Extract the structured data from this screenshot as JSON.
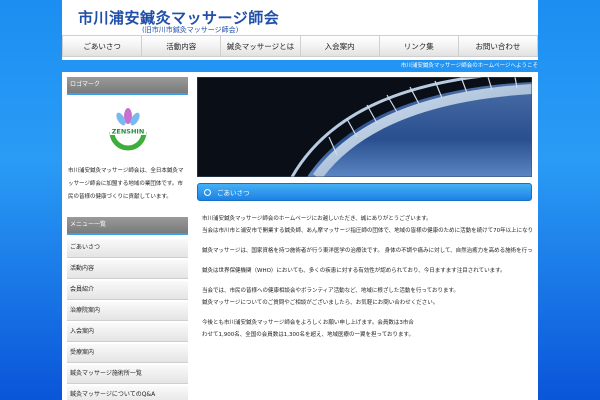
{
  "header": {
    "title": "市川浦安鍼灸マッサージ師会",
    "subtitle": "(旧市川市鍼灸マッサージ師会)"
  },
  "nav": {
    "items": [
      "ごあいさつ",
      "活動内容",
      "鍼灸マッサージとは",
      "入会案内",
      "リンク集",
      "お問い合わせ"
    ]
  },
  "ticker": "市川浦安鍼灸マッサージ師会のホームページへようこそ",
  "sidebar": {
    "logo_heading": "ロゴマーク",
    "logo_text": "ZENSHIN",
    "description": "市川浦安鍼灸マッサージ師会は、全日本鍼灸マッサージ師会に加盟する地域の業団体です。市民の皆様の健康づくりに貢献しています。",
    "menu_heading": "メニュー一覧",
    "menu_items": [
      "ごあいさつ",
      "活動内容",
      "会員紹介",
      "治療院案内",
      "入会案内",
      "受療案内",
      "鍼灸マッサージ施術所一覧",
      "鍼灸マッサージについてのQ&A"
    ]
  },
  "content": {
    "section_title": "ごあいさつ",
    "paragraphs": [
      "市川浦安鍼灸マッサージ師会のホームページにお越しいただき、誠にありがとうございます。",
      "当会は市川市と浦安市で開業する鍼灸師、あん摩マッサージ指圧師の団体で、地域の皆様の健康のために活動を続けて70年以上になります。",
      "鍼灸マッサージは、国家資格を持つ施術者が行う東洋医学の治療法です。 身体の不調や痛みに対して、自然治癒力を高める施術を行っています。",
      "鍼灸は世界保健機関（WHO）においても、多くの疾患に対する有効性が認められており、今日ますます注目されています。",
      "当会では、市民の皆様への健康相談会やボランティア活動など、地域に根ざした活動を行っております。",
      "鍼灸マッサージについてのご質問やご相談がございましたら、お気軽にお問い合わせください。",
      "今後とも市川浦安鍼灸マッサージ師会をよろしくお願い申し上げます。会員数は3市合",
      "わせて1,900名、全国の会員数は1,300名を超え、地域医療の一翼を担っております。"
    ]
  },
  "colors": {
    "accent": "#1c82e4",
    "title": "#1f4fa8"
  }
}
